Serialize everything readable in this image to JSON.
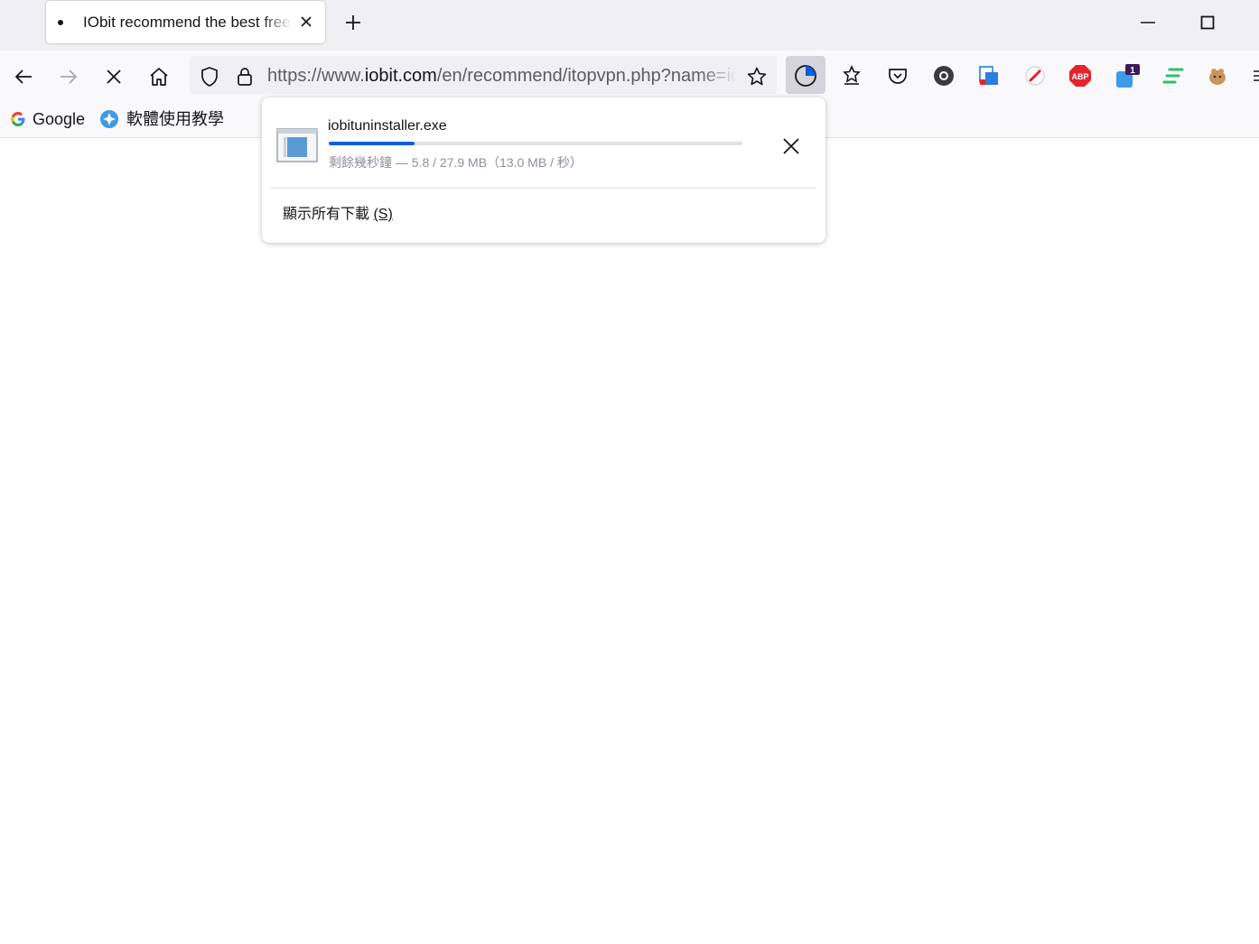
{
  "tab": {
    "title": "IObit recommend the best free Windows software"
  },
  "urlbar": {
    "scheme": "https://www.",
    "host": "iobit.com",
    "path": "/en/recommend/itopvpn.php?name=iobituninstaller"
  },
  "bookmarks": [
    {
      "label": "Google",
      "icon": "google-icon"
    },
    {
      "label": "軟體使用教學",
      "icon": "bookmark-icon"
    }
  ],
  "toolbar_badge": "1",
  "download": {
    "filename": "iobituninstaller.exe",
    "status": "剩餘幾秒鐘 — 5.8 / 27.9 MB（13.0 MB / 秒）",
    "progress_percent": 20.8,
    "show_all_label": "顯示所有下載",
    "show_all_accesskey": "(S)"
  },
  "colors": {
    "accent": "#0060df",
    "abp": "#e3242b",
    "titlebar": "#f0f0f4"
  }
}
